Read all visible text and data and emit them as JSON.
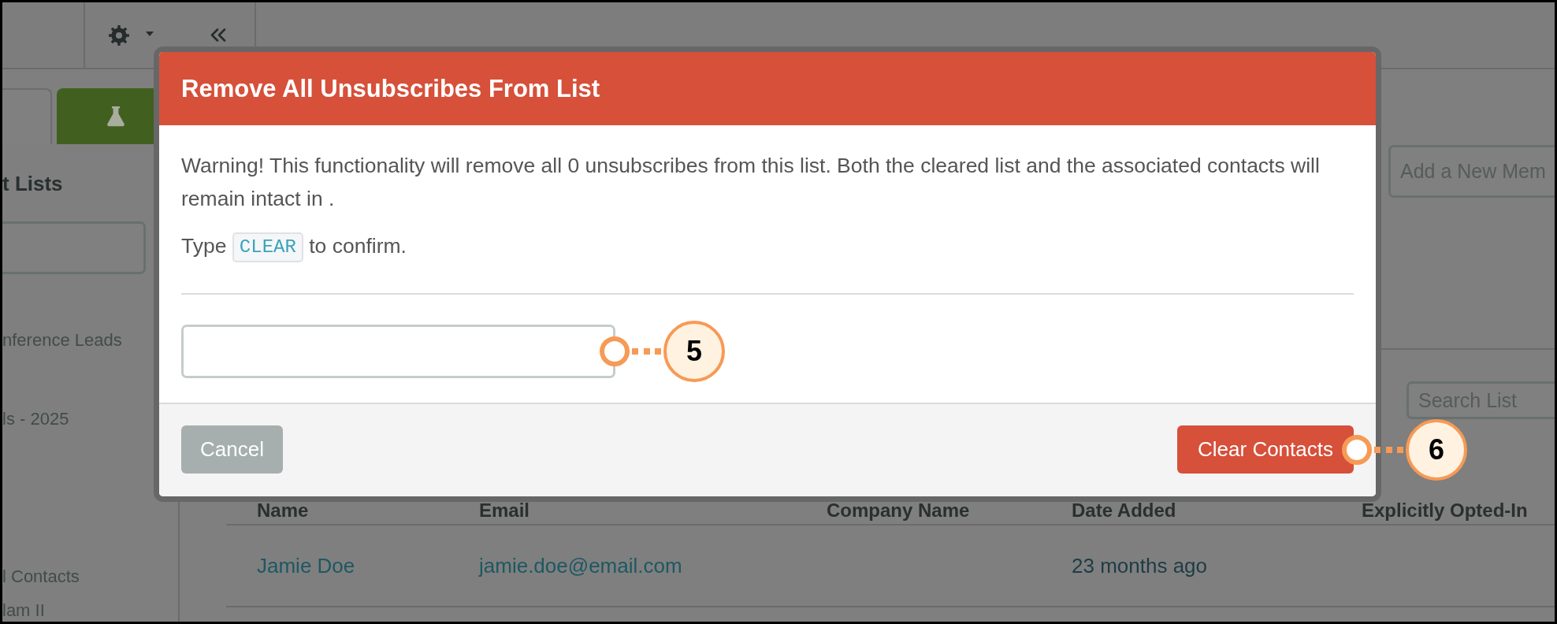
{
  "sidebar": {
    "heading": "t Lists",
    "lists": [
      {
        "name": "nference Leads"
      },
      {
        "name": "ls - 2025"
      },
      {
        "name": "l Contacts",
        "subtitle": "lam II"
      }
    ]
  },
  "main": {
    "add_member": {
      "placeholder": "Add a New Mem"
    },
    "search": {
      "placeholder": "Search List"
    },
    "table": {
      "columns": [
        "Name",
        "Email",
        "Company Name",
        "Date Added",
        "Explicitly Opted-In"
      ],
      "rows": [
        {
          "name": "Jamie Doe",
          "email": "jamie.doe@email.com",
          "date_added": "23 months ago"
        }
      ]
    }
  },
  "dialog": {
    "title": "Remove All Unsubscribes From List",
    "message": "Warning! This functionality will remove all 0 unsubscribes from this list. Both the cleared list and the associated contacts will remain intact in .",
    "prompt": {
      "before": "Type",
      "code": "CLEAR",
      "after": "to confirm."
    },
    "input": {
      "callout": "5"
    },
    "buttons": [
      {
        "label": "Cancel",
        "kind": "secondary"
      },
      {
        "label": "Clear Contacts",
        "kind": "danger",
        "callout": "6"
      }
    ]
  }
}
